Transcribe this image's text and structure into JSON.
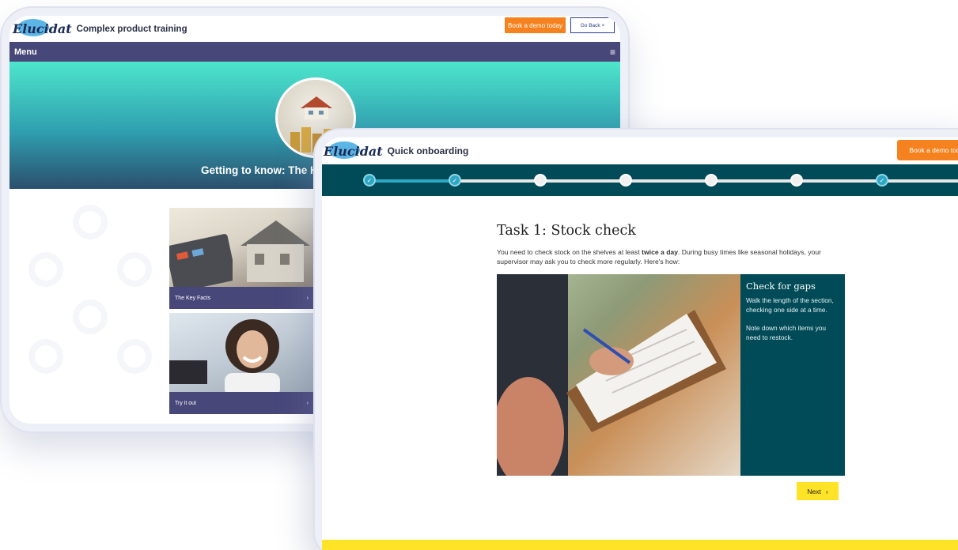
{
  "back_window": {
    "logo": "Elucidat",
    "title": "Complex product training",
    "demo_button": "Book a demo today",
    "go_back_button": "Go Back",
    "go_back_icon": "×",
    "menu_label": "Menu",
    "menu_icon": "≡",
    "hero_title": "Getting to know: The Ho",
    "cards": [
      {
        "label": "The Key Facts",
        "arrow": "›"
      },
      {
        "label": "Try it out",
        "arrow": "›"
      }
    ]
  },
  "front_window": {
    "logo": "Elucidat",
    "title": "Quick onboarding",
    "demo_button": "Book a demo tod",
    "progress": {
      "total_steps": 7,
      "completed_steps": [
        1,
        2,
        7
      ],
      "check": "✓"
    },
    "task_title": "Task 1: Stock check",
    "intro_before": "You need to check stock on the shelves at least ",
    "intro_bold": "twice a day",
    "intro_after": ". During busy times like seasonal holidays, your supervisor may ask you to check more regularly. Here's how:",
    "side_title": "Check for gaps",
    "side_p1": "Walk the length of the section, checking one side at a time.",
    "side_p2": "Note down which items you need to restock.",
    "next_button": "Next",
    "next_icon": "›"
  },
  "colors": {
    "orange": "#f5821f",
    "purple": "#48477a",
    "teal_dark": "#004b57",
    "teal_light": "#2ea7c4",
    "yellow": "#ffe326"
  }
}
